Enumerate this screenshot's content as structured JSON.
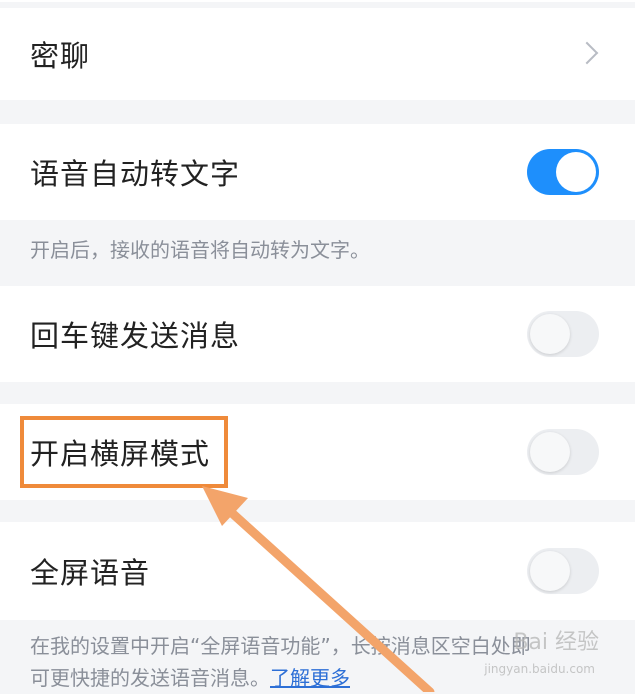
{
  "rows": {
    "secret_chat": {
      "label": "密聊"
    },
    "voice_to_text": {
      "label": "语音自动转文字",
      "enabled": true
    },
    "voice_to_text_hint": "开启后，接收的语音将自动转为文字。",
    "enter_to_send": {
      "label": "回车键发送消息",
      "enabled": false
    },
    "landscape_mode": {
      "label": "开启横屏模式",
      "enabled": false
    },
    "fullscreen_voice": {
      "label": "全屏语音",
      "enabled": false
    }
  },
  "fullscreen_hint": {
    "line1": "在我的设置中开启“全屏语音功能”，长按消息区空白处即",
    "line2": "可更快捷的发送语音消息。",
    "link": "了解更多"
  },
  "watermark": {
    "text": "Bai 经验",
    "sub": "jingyan.baidu.com"
  },
  "colors": {
    "toggle_on": "#1e8ffc",
    "highlight": "#ef8a3a",
    "link": "#2d6fd6"
  }
}
